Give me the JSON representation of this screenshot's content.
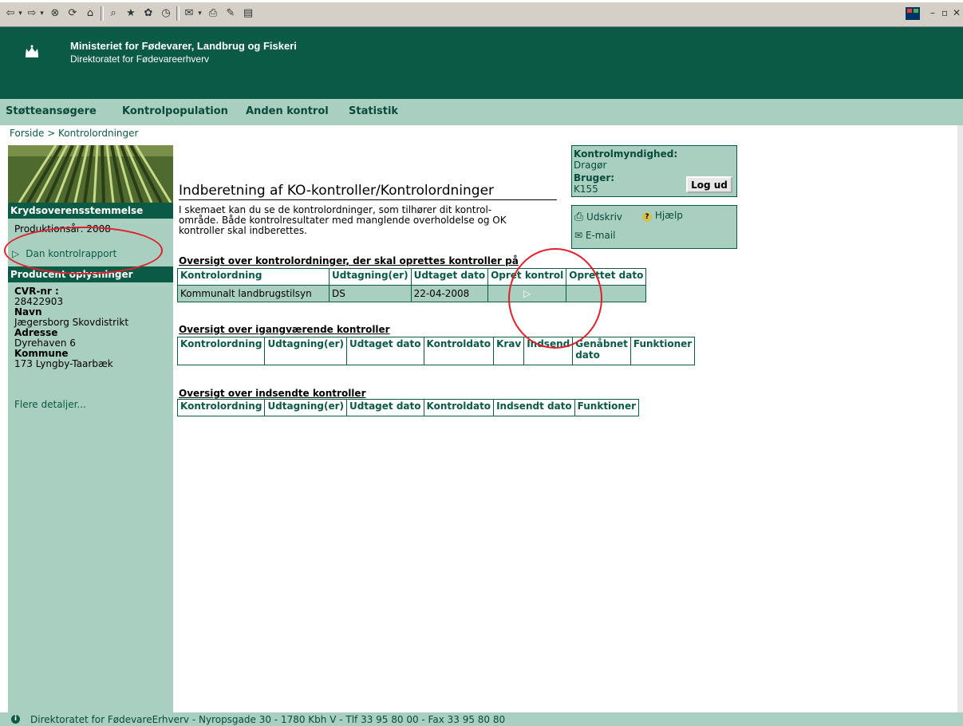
{
  "browser": {
    "toolbar_glyphs": [
      "⇦",
      "▾",
      "⇨",
      "▾",
      "⊗",
      "⟳",
      "⌂",
      "⌕",
      "★",
      "✿",
      "◷",
      "✉",
      "▾",
      "⎙",
      "✎",
      "▤"
    ],
    "window_controls": [
      "–",
      "▫",
      "✕"
    ]
  },
  "header": {
    "ministry": "Ministeriet for Fødevarer, Landbrug og Fiskeri",
    "directorate": "Direktoratet for Fødevareerhverv"
  },
  "nav": {
    "items": [
      "Støtteansøgere",
      "Kontrolpopulation",
      "Anden kontrol",
      "Statistik"
    ]
  },
  "breadcrumb": {
    "home": "Forside",
    "separator": " > ",
    "current": "Kontrolordninger"
  },
  "sidebar": {
    "cross_compliance_heading": "Krydsoverensstemmelse",
    "production_year": "Produktionsår: 2008",
    "create_report_link": "Dan kontrolrapport",
    "producer_heading": "Producent oplysninger",
    "cvr_label": "CVR-nr :",
    "cvr_value": "28422903",
    "name_label": "Navn",
    "name_value": "Jægersborg Skovdistrikt",
    "address_label": "Adresse",
    "address_value": "Dyrehaven 6",
    "municipality_label": "Kommune",
    "municipality_value": "173 Lyngby-Taarbæk",
    "more_details_link": "Flere detaljer..."
  },
  "main": {
    "title": "Indberetning af KO-kontroller/Kontrolordninger",
    "intro_line1": "I skemaet kan du se de kontrolordninger, som tilhører dit kontrol-",
    "intro_line2": "område. Både kontrolresultater med manglende overholdelse og OK",
    "intro_line3": "kontroller skal indberettes.",
    "section1": {
      "title": "Oversigt over kontrolordninger, der skal oprettes kontroller på",
      "headers": [
        "Kontrolordning",
        "Udtagning(er)",
        "Udtaget dato",
        "Opret kontrol",
        "Oprettet dato"
      ],
      "rows": [
        {
          "scheme": "Kommunalt landbrugstilsyn",
          "selection": "DS",
          "date": "22-04-2008",
          "created": ""
        }
      ]
    },
    "section2": {
      "title": "Oversigt over igangværende kontroller",
      "headers": [
        "Kontrolordning",
        "Udtagning(er)",
        "Udtaget dato",
        "Kontroldato",
        "Krav",
        "Indsend"
      ],
      "reopened_line1": "Genåbnet",
      "reopened_line2": "dato",
      "functions": "Funktioner"
    },
    "section3": {
      "title": "Oversigt over indsendte kontroller",
      "headers": [
        "Kontrolordning",
        "Udtagning(er)",
        "Udtaget dato",
        "Kontroldato",
        "Indsendt dato",
        "Funktioner"
      ]
    }
  },
  "authority": {
    "authority_label": "Kontrolmyndighed:",
    "authority_value": "Dragør",
    "user_label": "Bruger:",
    "user_value": "K155",
    "logout": "Log ud"
  },
  "tools": {
    "print": "Udskriv",
    "help": "Hjælp",
    "email": "E-mail"
  },
  "footer": {
    "text": "Direktoratet for FødevareErhverv - Nyropsgade 30 - 1780 Kbh V - Tlf 33 95 80 00 - Fax 33 95 80 80"
  },
  "colors": {
    "brand_green": "#0a5a45",
    "light_green": "#a9cfc1",
    "annotation_red": "#e0202a"
  }
}
